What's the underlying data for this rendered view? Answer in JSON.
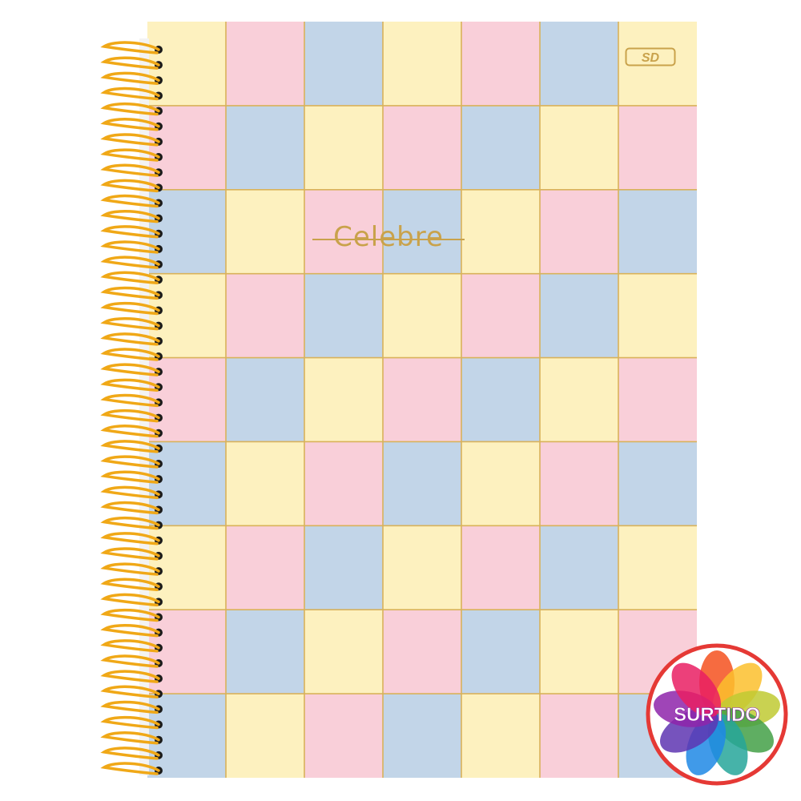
{
  "notebook": {
    "brand_logo": "SD",
    "cover_title": "Celebre",
    "colors": {
      "yellow": "#fdf1bf",
      "pink": "#f9cfd9",
      "blue": "#c2d5e8",
      "gold_lines": "#d9b25a",
      "wire": "#f0a817"
    },
    "grid": {
      "rows": [
        [
          "yellow",
          "pink",
          "blue",
          "yellow",
          "pink",
          "blue",
          "yellow"
        ],
        [
          "pink",
          "blue",
          "yellow",
          "pink",
          "blue",
          "yellow",
          "pink"
        ],
        [
          "blue",
          "yellow",
          "pink",
          "blue",
          "yellow",
          "pink",
          "blue"
        ],
        [
          "yellow",
          "pink",
          "blue",
          "yellow",
          "pink",
          "blue",
          "yellow"
        ],
        [
          "pink",
          "blue",
          "yellow",
          "pink",
          "blue",
          "yellow",
          "pink"
        ],
        [
          "blue",
          "yellow",
          "pink",
          "blue",
          "yellow",
          "pink",
          "blue"
        ],
        [
          "yellow",
          "pink",
          "blue",
          "yellow",
          "pink",
          "blue",
          "yellow"
        ],
        [
          "pink",
          "blue",
          "yellow",
          "pink",
          "blue",
          "yellow",
          "pink"
        ],
        [
          "blue",
          "yellow",
          "pink",
          "blue",
          "yellow",
          "pink",
          "blue"
        ]
      ]
    }
  },
  "badge": {
    "label": "SURTIDO",
    "ring_color": "#e53935",
    "petal_colors": [
      "#f4511e",
      "#fbc02d",
      "#c0ca33",
      "#43a047",
      "#26a69a",
      "#1e88e5",
      "#5e35b1",
      "#8e24aa",
      "#e91e63"
    ]
  }
}
